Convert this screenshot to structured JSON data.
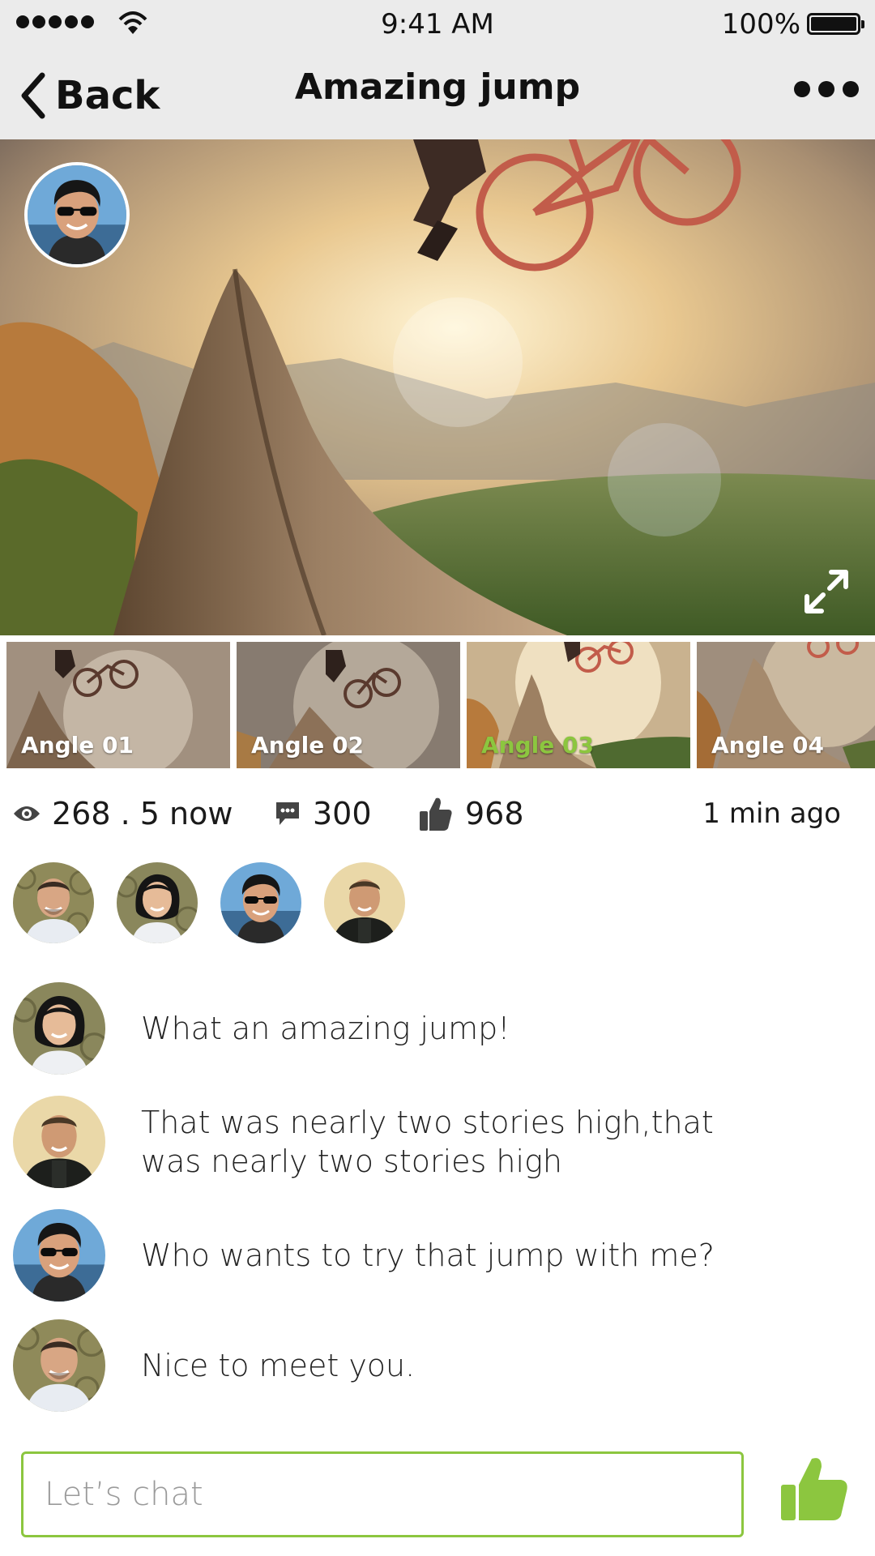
{
  "status_bar": {
    "time": "9:41 AM",
    "battery": "100%",
    "signal_icon": "signal-dots-icon",
    "wifi_icon": "wifi-icon",
    "battery_icon": "battery-icon"
  },
  "nav": {
    "back_label": "Back",
    "title": "Amazing jump",
    "more_icon": "more-icon"
  },
  "hero": {
    "image": "mountain-bike-jump-photo",
    "expand_icon": "expand-icon"
  },
  "angles": [
    {
      "label": "Angle 01",
      "active": false
    },
    {
      "label": "Angle 02",
      "active": false
    },
    {
      "label": "Angle 03",
      "active": true
    },
    {
      "label": "Angle 04",
      "active": false
    }
  ],
  "stats": {
    "views": "268 . 5 now",
    "comments": "300",
    "likes": "968",
    "time_ago": "1 min ago"
  },
  "viewers_count": 4,
  "chat": [
    {
      "text": "What an amazing jump!"
    },
    {
      "text": "That was nearly two stories high,that was nearly two stories high"
    },
    {
      "text": "Who wants to try that jump with me?"
    },
    {
      "text": "Nice to meet you."
    }
  ],
  "input": {
    "placeholder": "Let’s chat"
  },
  "colors": {
    "accent": "#8cc63f",
    "topbar": "#ebebeb",
    "text": "#1a1a1a"
  }
}
